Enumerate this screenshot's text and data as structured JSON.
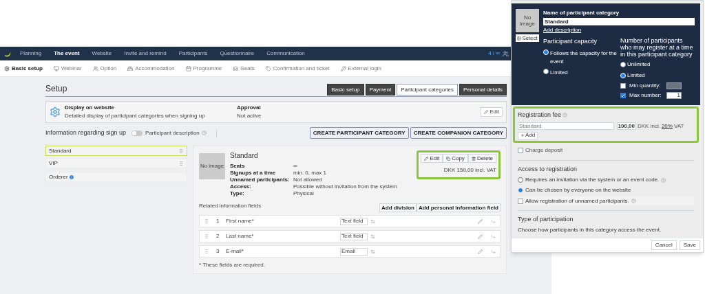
{
  "nav": {
    "items": [
      {
        "label": "Planning",
        "selected": false
      },
      {
        "label": "The event",
        "selected": true
      },
      {
        "label": "Website",
        "selected": false
      },
      {
        "label": "Invite and remind",
        "selected": false
      },
      {
        "label": "Participants",
        "selected": false
      },
      {
        "label": "Questionnaire",
        "selected": false
      },
      {
        "label": "Communication",
        "selected": false
      }
    ],
    "counter": "4 / ∞"
  },
  "subnav": {
    "items": [
      {
        "label": "Basic setup",
        "selected": true
      },
      {
        "label": "Webinar",
        "selected": false
      },
      {
        "label": "Option",
        "selected": false
      },
      {
        "label": "Accommodation",
        "selected": false
      },
      {
        "label": "Programme",
        "selected": false
      },
      {
        "label": "Seats",
        "selected": false
      },
      {
        "label": "Confirmation and ticket",
        "selected": false
      },
      {
        "label": "External login",
        "selected": false
      }
    ]
  },
  "setup": {
    "title": "Setup",
    "tabs": [
      {
        "label": "Basic setup",
        "selected": false
      },
      {
        "label": "Payment",
        "selected": false
      },
      {
        "label": "Participant categories",
        "selected": true
      },
      {
        "label": "Personal details",
        "selected": false
      }
    ]
  },
  "display_card": {
    "title": "Display on website",
    "description": "Detailed display of participant categories when signing up",
    "approval_label": "Approval",
    "approval_value": "Not active",
    "edit_button": "Edit"
  },
  "signup": {
    "title": "Information regarding sign up",
    "toggle": {
      "label": "Participant description",
      "on": false
    },
    "buttons": [
      "CREATE PARTICIPANT CATEGORY",
      "CREATE COMPANION CATEGORY"
    ]
  },
  "categories": [
    {
      "label": "Standard",
      "selected": true,
      "kind": "draggable"
    },
    {
      "label": "VIP",
      "selected": false,
      "kind": "draggable"
    },
    {
      "label": "Orderer",
      "selected": false,
      "kind": "info"
    }
  ],
  "detail": {
    "image": "No image",
    "title": "Standard",
    "properties": [
      {
        "label": "Seats",
        "value": "∞"
      },
      {
        "label": "Signups at a time",
        "value": "min. 0, max 1"
      },
      {
        "label": "Unnamed participants:",
        "value": "Not allowed"
      },
      {
        "label": "Access:",
        "value": "Possible without invitation from the system"
      },
      {
        "label": "Type:",
        "value": "Physical"
      }
    ],
    "actions": [
      "Edit",
      "Copy",
      "Delete"
    ],
    "price": "DKK 150,00 incl. VAT",
    "related_title": "Related information fields",
    "related_buttons": [
      "Add division",
      "Add personal information field"
    ],
    "fields": [
      {
        "number": "1",
        "name": "First name*",
        "type": "Text field"
      },
      {
        "number": "2",
        "name": "Last name*",
        "type": "Text field"
      },
      {
        "number": "3",
        "name": "E-mail*",
        "type": "Email"
      }
    ],
    "footnote": "* These fields are required."
  },
  "dialog": {
    "image": "No image",
    "select_button": "Select",
    "name_label": "Name of participant category",
    "name_value": "Standard",
    "add_description": "Add description",
    "capacity": {
      "title": "Participant capacity",
      "options": [
        {
          "label": "Follows the capacity for the event",
          "selected": true
        },
        {
          "label": "Limited",
          "selected": false
        }
      ]
    },
    "per_registration": {
      "title": "Number of participants who may register at a time in this participant category",
      "options": [
        {
          "label": "Unlimited",
          "selected": false
        },
        {
          "label": "Limited",
          "selected": true
        }
      ],
      "min": {
        "label": "Min quantity:",
        "checked": false
      },
      "max": {
        "label": "Max number:",
        "checked": true,
        "value": "1"
      }
    },
    "fee": {
      "title": "Registration fee",
      "name": "Standard",
      "amount": "100,00",
      "currency": "DKK incl.",
      "vat": "20%",
      "vat_suffix": "VAT",
      "add": "Add"
    },
    "deposit": {
      "label": "Charge deposit",
      "checked": false
    },
    "access": {
      "title": "Access to registration",
      "options": [
        {
          "label": "Requires an invitation via the system or an event code.",
          "selected": false
        },
        {
          "label": "Can be chosen by everyone on the website",
          "selected": true
        }
      ],
      "unnamed": {
        "label": "Allow registration of unnamed participants.",
        "checked": false
      }
    },
    "participation": {
      "title": "Type of participation",
      "description": "Choose how participants in this category access the event."
    },
    "buttons": [
      "Cancel",
      "Save"
    ]
  }
}
